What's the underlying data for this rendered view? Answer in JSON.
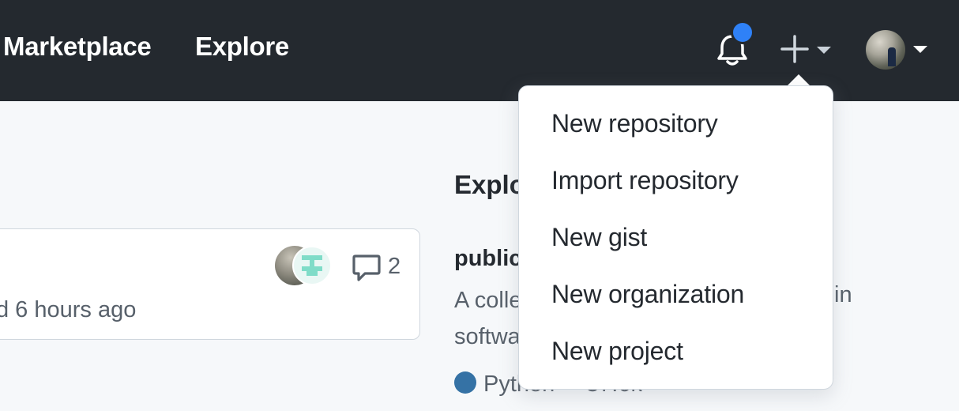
{
  "header": {
    "nav": [
      {
        "label": "Marketplace"
      },
      {
        "label": "Explore"
      }
    ],
    "notification_dot_color": "#2f81f7",
    "icons": [
      "bell-icon",
      "plus-icon",
      "chevron-down-icon",
      "avatar"
    ]
  },
  "create_menu": {
    "items": [
      {
        "label": "New repository"
      },
      {
        "label": "Import repository"
      },
      {
        "label": "New gist"
      },
      {
        "label": "New organization"
      },
      {
        "label": "New project"
      }
    ]
  },
  "feed_card": {
    "comment_count": "2",
    "time_text": "d 6 hours ago"
  },
  "explore": {
    "title": "Explo",
    "repo_name": "public",
    "description_line1": "A colle",
    "description_line1_end": "in",
    "description_line2": "softwa",
    "language": "Python",
    "language_color": "#3572A5",
    "stars": "37.6k"
  }
}
